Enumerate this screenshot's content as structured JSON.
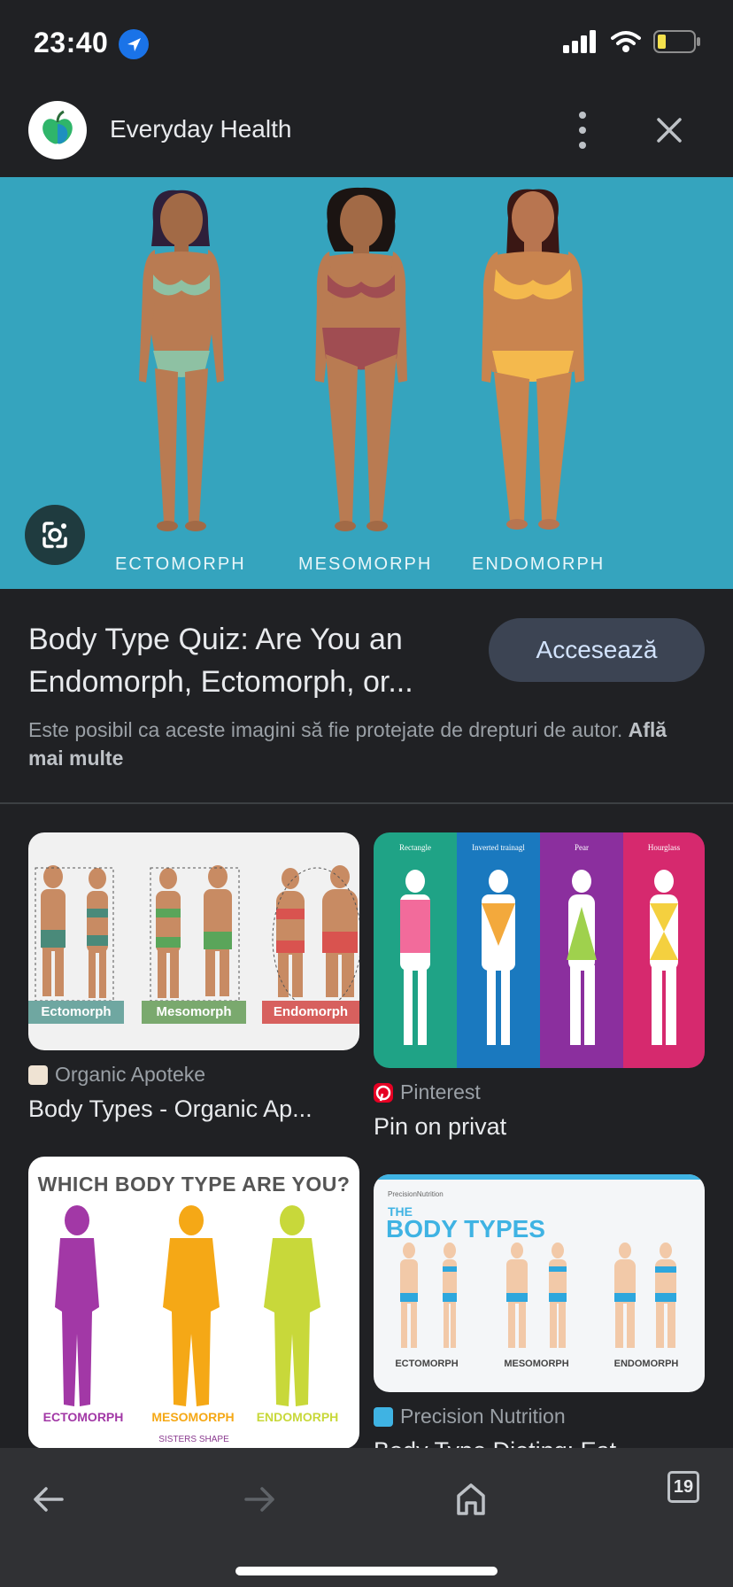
{
  "status_bar": {
    "time": "23:40"
  },
  "header": {
    "site_title": "Everyday Health"
  },
  "hero": {
    "labels": [
      "ECTOMORPH",
      "MESOMORPH",
      "ENDOMORPH"
    ]
  },
  "result": {
    "title": "Body Type Quiz: Are You an Endomorph, Ectomorph, or...",
    "visit_label": "Accesează",
    "copyright_text": "Este posibil ca aceste imagini să fie protejate de drepturi de autor.",
    "learn_more": "Află mai multe"
  },
  "related": [
    {
      "source": "Organic Apoteke",
      "title": "Body Types - Organic Ap...",
      "thumb_labels": [
        "Ectomorph",
        "Mesomorph",
        "Endomorph"
      ]
    },
    {
      "source": "Pinterest",
      "title": "Pin on privat",
      "thumb_labels": [
        "Rectangle",
        "Inverted trainagl",
        "Pear",
        "Hourglass"
      ]
    },
    {
      "source": "",
      "title": "",
      "thumb_heading": "WHICH BODY TYPE ARE YOU?",
      "thumb_labels": [
        "ECTOMORPH",
        "MESOMORPH",
        "ENDOMORPH"
      ],
      "thumb_footer": "SISTERS SHAPE"
    },
    {
      "source": "Precision Nutrition",
      "title": "Body Type Dieting: Eat...",
      "thumb_brand": "PrecisionNutrition",
      "thumb_heading_small": "THE",
      "thumb_heading": "BODY TYPES",
      "thumb_labels": [
        "ECTOMORPH",
        "MESOMORPH",
        "ENDOMORPH"
      ]
    }
  ],
  "bottom_bar": {
    "tab_count": "19"
  },
  "colors": {
    "background": "#202124",
    "hero_bg": "#35a4be",
    "button_bg": "#3c4453",
    "accent": "#1a73e8"
  }
}
